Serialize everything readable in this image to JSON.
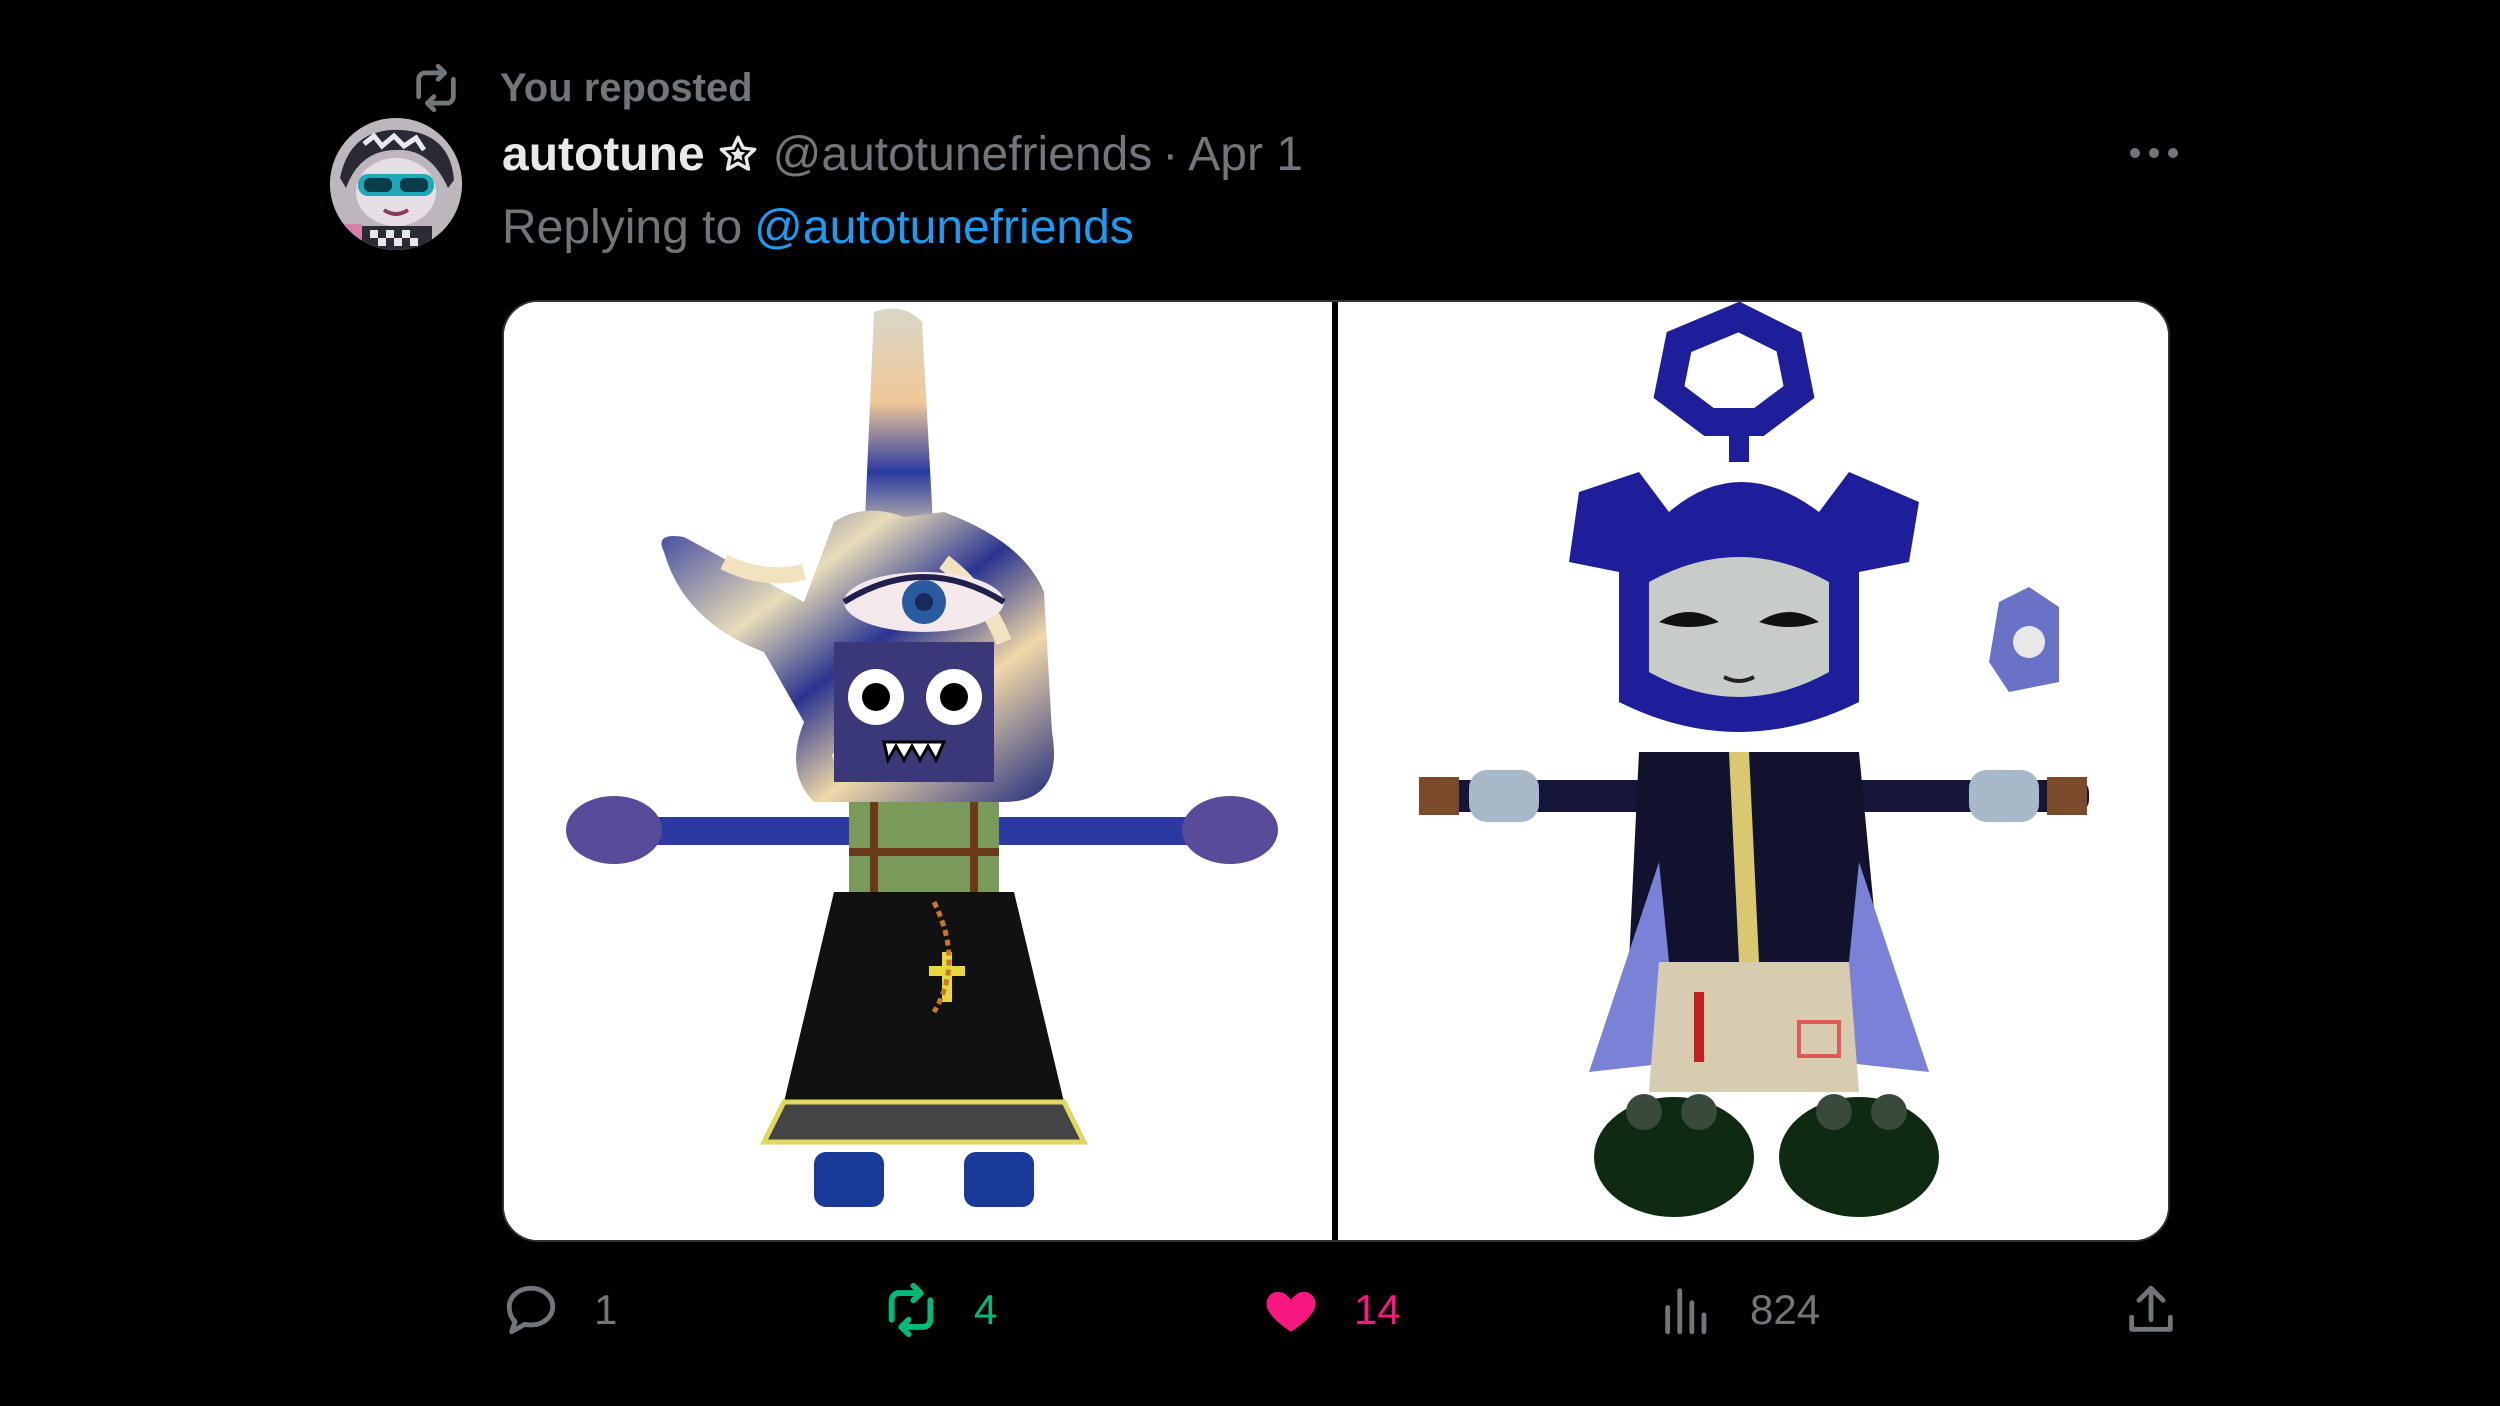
{
  "repost_banner": {
    "text": "You reposted",
    "icon": "repost-icon"
  },
  "author": {
    "name": "autotune",
    "badge_icon": "star-outline-icon",
    "handle": "@autotunefriends",
    "separator": "·",
    "date": "Apr 1"
  },
  "reply": {
    "prefix": "Replying to",
    "mention": "@autotunefriends"
  },
  "media": {
    "left_image": "3d-avatar-hand-head-character",
    "right_image": "3d-avatar-blue-antenna-character"
  },
  "actions": {
    "reply_count": "1",
    "repost_count": "4",
    "like_count": "14",
    "view_count": "824",
    "share_icon": "share-icon"
  },
  "colors": {
    "background": "#000000",
    "muted": "#71767b",
    "link": "#1d9bf0",
    "repost_active": "#00ba7c",
    "like_active": "#f91880",
    "text_primary": "#e7e9ea"
  }
}
